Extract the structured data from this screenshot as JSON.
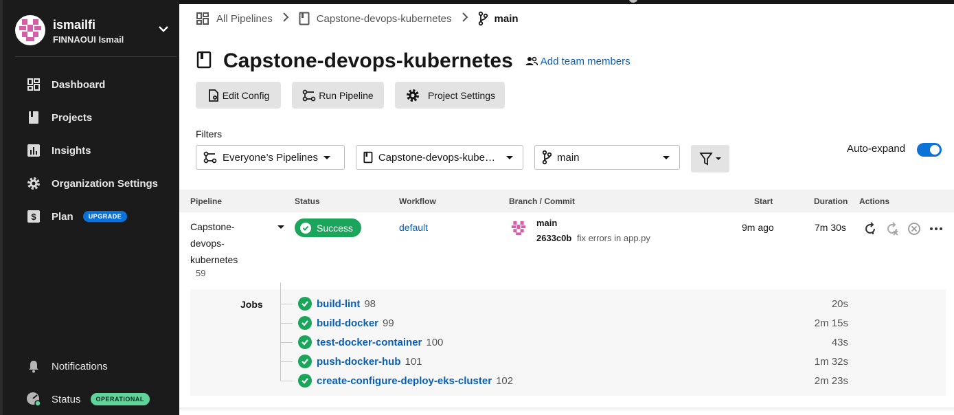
{
  "user": {
    "username": "ismailfi",
    "full_name": "FINNAOUI Ismail"
  },
  "sidebar": {
    "items": [
      {
        "label": "Dashboard",
        "icon": "dashboard-icon"
      },
      {
        "label": "Projects",
        "icon": "projects-icon"
      },
      {
        "label": "Insights",
        "icon": "insights-icon"
      },
      {
        "label": "Organization Settings",
        "icon": "gear-icon"
      },
      {
        "label": "Plan",
        "icon": "dollar-icon",
        "badge": "UPGRADE"
      }
    ],
    "bottom": [
      {
        "label": "Notifications",
        "icon": "bell-icon"
      },
      {
        "label": "Status",
        "icon": "status-icon",
        "badge": "OPERATIONAL"
      }
    ]
  },
  "breadcrumb": {
    "root": "All Pipelines",
    "project": "Capstone-devops-kubernetes",
    "branch": "main"
  },
  "header": {
    "title": "Capstone-devops-kubernetes",
    "team_link": "Add team members"
  },
  "toolbar": {
    "edit_config": "Edit Config",
    "run_pipeline": "Run Pipeline",
    "project_settings": "Project Settings"
  },
  "filters": {
    "label": "Filters",
    "pipelines": "Everyone’s Pipelines",
    "project": "Capstone-devops-kubernetes",
    "branch": "main",
    "auto_expand_label": "Auto-expand",
    "auto_expand_on": true
  },
  "table": {
    "headers": {
      "pipeline": "Pipeline",
      "status": "Status",
      "workflow": "Workflow",
      "branch_commit": "Branch / Commit",
      "start": "Start",
      "duration": "Duration",
      "actions": "Actions"
    },
    "row": {
      "name_lines": [
        "Capstone-",
        "devops-",
        "kubernetes"
      ],
      "number": "59",
      "status": "Success",
      "workflow": "default",
      "branch": "main",
      "commit_hash": "2633c0b",
      "commit_msg": "fix errors in app.py",
      "start": "9m ago",
      "duration": "7m 30s"
    },
    "jobs_label": "Jobs",
    "jobs": [
      {
        "name": "build-lint",
        "number": "98",
        "duration": "20s"
      },
      {
        "name": "build-docker",
        "number": "99",
        "duration": "2m 15s"
      },
      {
        "name": "test-docker-container",
        "number": "100",
        "duration": "43s"
      },
      {
        "name": "push-docker-hub",
        "number": "101",
        "duration": "1m 32s"
      },
      {
        "name": "create-configure-deploy-eks-cluster",
        "number": "102",
        "duration": "2m 23s"
      }
    ]
  },
  "colors": {
    "accent": "#0b72d8",
    "success": "#1aa55b",
    "link": "#0a5fb5",
    "sidebar_bg": "#1b1b1b"
  }
}
